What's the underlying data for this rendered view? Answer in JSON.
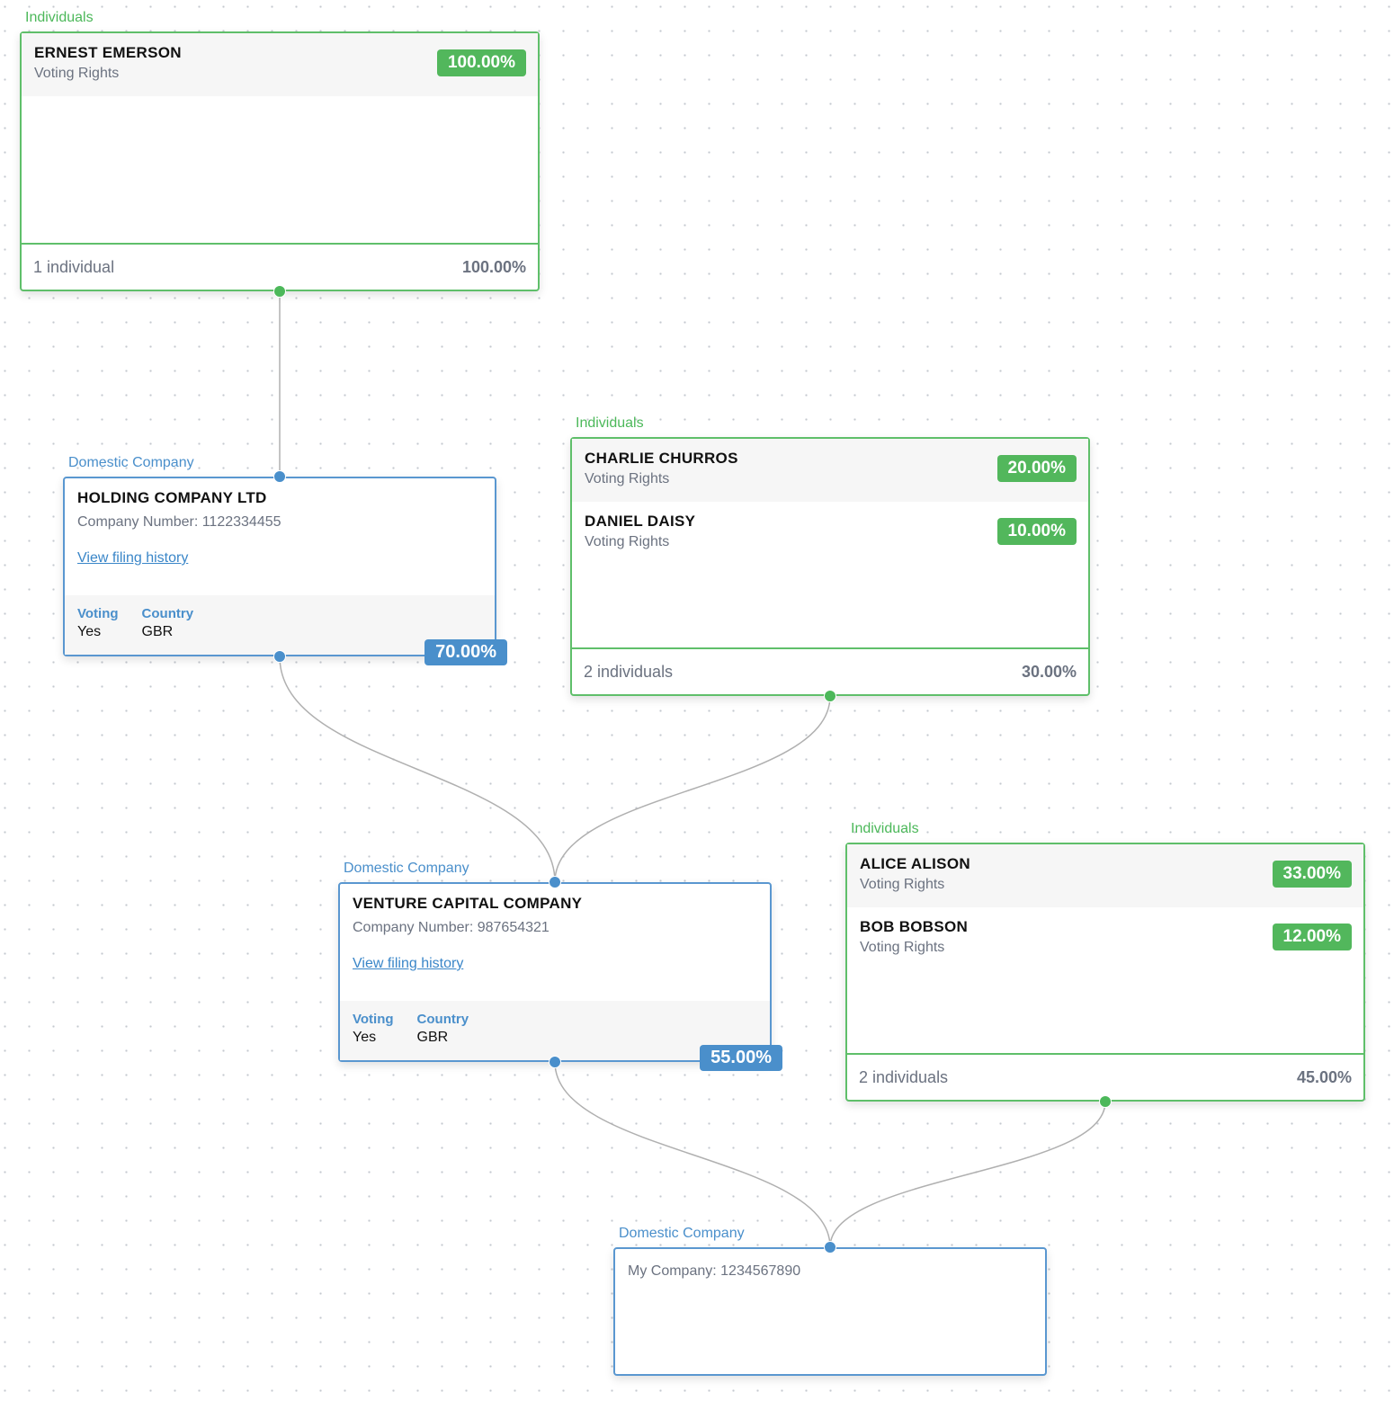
{
  "colors": {
    "individual": "#4cb85a",
    "company": "#4a8fcb",
    "edge": "#b0b0b0"
  },
  "individual_groups": [
    {
      "id": "g1",
      "type_label": "Individuals",
      "members": [
        {
          "name": "ERNEST EMERSON",
          "right": "Voting Rights",
          "percent": "100.00%"
        }
      ],
      "count_label": "1 individual",
      "total": "100.00%"
    },
    {
      "id": "g2",
      "type_label": "Individuals",
      "members": [
        {
          "name": "CHARLIE CHURROS",
          "right": "Voting Rights",
          "percent": "20.00%"
        },
        {
          "name": "DANIEL DAISY",
          "right": "Voting Rights",
          "percent": "10.00%"
        }
      ],
      "count_label": "2 individuals",
      "total": "30.00%"
    },
    {
      "id": "g3",
      "type_label": "Individuals",
      "members": [
        {
          "name": "ALICE ALISON",
          "right": "Voting Rights",
          "percent": "33.00%"
        },
        {
          "name": "BOB BOBSON",
          "right": "Voting Rights",
          "percent": "12.00%"
        }
      ],
      "count_label": "2 individuals",
      "total": "45.00%"
    }
  ],
  "companies": [
    {
      "id": "c1",
      "type_label": "Domestic Company",
      "name": "HOLDING COMPANY LTD",
      "number": "Company Number: 1122334455",
      "link": "View filing history",
      "voting_label": "Voting",
      "voting": "Yes",
      "country_label": "Country",
      "country": "GBR",
      "percent": "70.00%"
    },
    {
      "id": "c2",
      "type_label": "Domestic Company",
      "name": "VENTURE CAPITAL COMPANY",
      "number": "Company Number: 987654321",
      "link": "View filing history",
      "voting_label": "Voting",
      "voting": "Yes",
      "country_label": "Country",
      "country": "GBR",
      "percent": "55.00%"
    },
    {
      "id": "c3",
      "type_label": "Domestic Company",
      "number": "My Company: 1234567890"
    }
  ],
  "edges": [
    [
      "g1",
      "c1"
    ],
    [
      "c1",
      "c2"
    ],
    [
      "g2",
      "c2"
    ],
    [
      "c2",
      "c3"
    ],
    [
      "g3",
      "c3"
    ]
  ]
}
